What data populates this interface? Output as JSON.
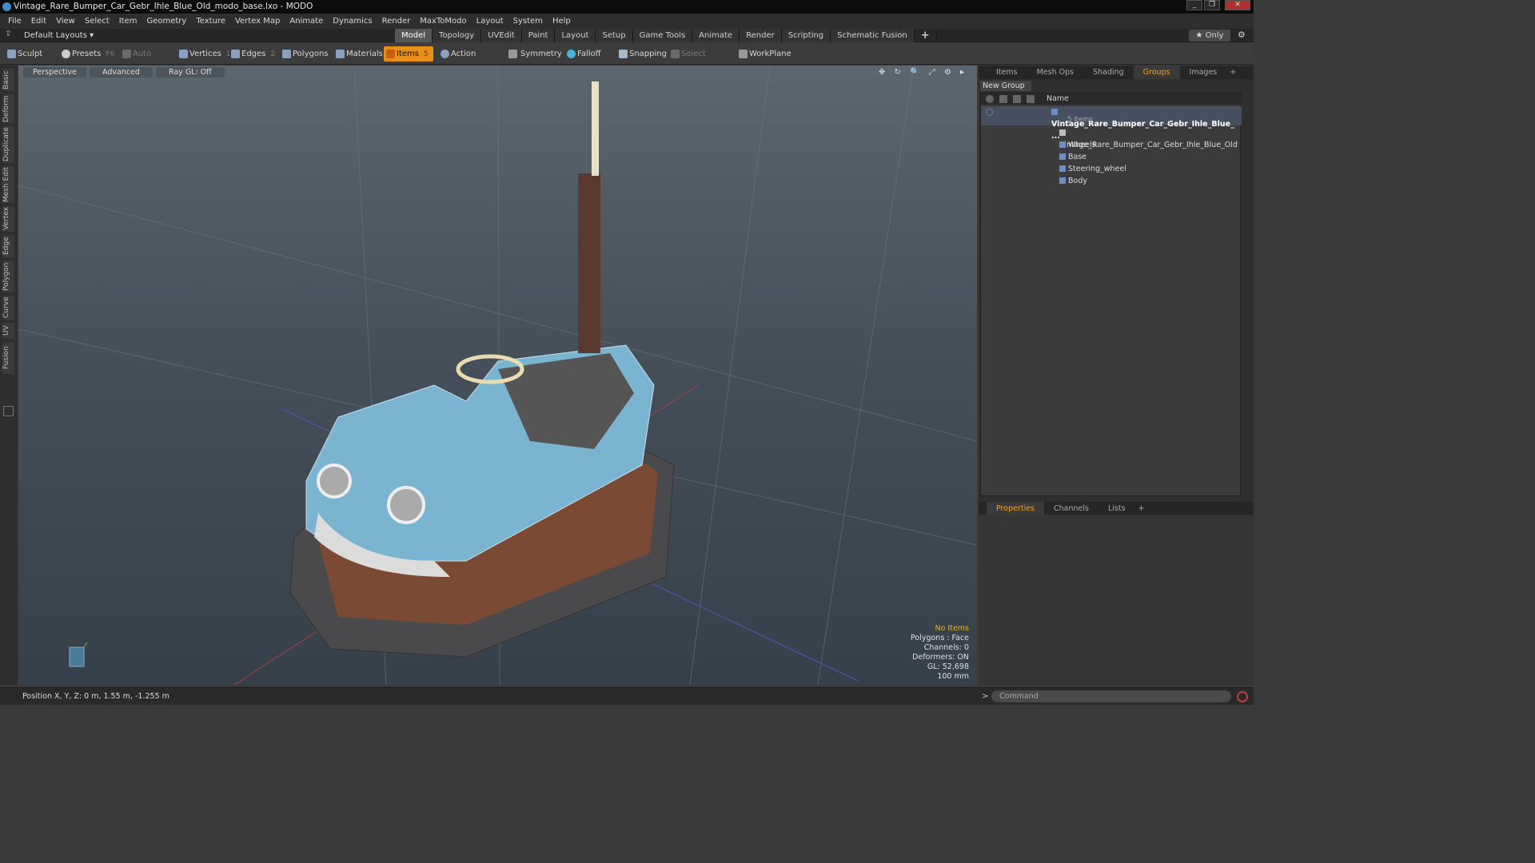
{
  "window": {
    "title": "Vintage_Rare_Bumper_Car_Gebr_Ihle_Blue_Old_modo_base.lxo - MODO",
    "buttons": [
      "_",
      "❐",
      "✕"
    ]
  },
  "menu": [
    "File",
    "Edit",
    "View",
    "Select",
    "Item",
    "Geometry",
    "Texture",
    "Vertex Map",
    "Animate",
    "Dynamics",
    "Render",
    "MaxToModo",
    "Layout",
    "System",
    "Help"
  ],
  "layout": {
    "selector": "Default Layouts ▾",
    "tabs": [
      "Model",
      "Topology",
      "UVEdit",
      "Paint",
      "Layout",
      "Setup",
      "Game Tools",
      "Animate",
      "Render",
      "Scripting",
      "Schematic Fusion"
    ],
    "active_tab": "Model",
    "add": "+",
    "only": "★ Only",
    "gear": "⚙"
  },
  "toolbar": {
    "sculpt": "Sculpt",
    "presets": "Presets",
    "presets_key": "F6",
    "auto_select": "Auto Select",
    "vertices": "Vertices",
    "vertices_count": "1",
    "edges": "Edges",
    "edges_count": "2",
    "polygons": "Polygons",
    "materials": "Materials",
    "items": "Items",
    "items_count": "5",
    "action_center": "Action Center",
    "symmetry": "Symmetry",
    "falloff": "Falloff",
    "snapping": "Snapping",
    "select_through": "Select Through",
    "workplane": "WorkPlane"
  },
  "left_tabs": [
    "Basic",
    "Deform",
    "Duplicate",
    "Mesh Edit",
    "Vertex",
    "Edge",
    "Polygon",
    "Curve",
    "UV",
    "Fusion"
  ],
  "viewport": {
    "view": "Perspective",
    "shading": "Advanced",
    "raygl": "Ray GL: Off",
    "icons": "✥ ↻ 🔍 ⤢ ⚙ ▸"
  },
  "stats": {
    "selection": "No Items",
    "polygons": "Polygons : Face",
    "channels": "Channels: 0",
    "deformers": "Deformers: ON",
    "gl": "GL: 52,698",
    "scale": "100 mm"
  },
  "right_panel": {
    "tabs": [
      "Items",
      "Mesh Ops",
      "Shading",
      "Groups",
      "Images",
      "+"
    ],
    "active_tab": "Groups",
    "new_group": "New Group",
    "col_name": "Name",
    "root": {
      "name": "Vintage_Rare_Bumper_Car_Gebr_Ihle_Blue_ ...",
      "count": "5 Items"
    },
    "children": [
      "Vintage_Rare_Bumper_Car_Gebr_Ihle_Blue_Old",
      "Wheels",
      "Base",
      "Steering_wheel",
      "Body"
    ],
    "props_tabs": [
      "Properties",
      "Channels",
      "Lists",
      "+"
    ],
    "props_active": "Properties"
  },
  "status": {
    "position": "Position X, Y, Z:  0 m, 1.55 m, -1.255 m",
    "command_placeholder": "Command",
    "prompt": ">"
  }
}
